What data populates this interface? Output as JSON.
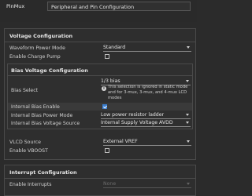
{
  "header": {
    "tag": "PinMux",
    "field_value": "Peripheral and Pin Configuration"
  },
  "voltage": {
    "title": "Voltage Configuration",
    "waveform_label": "Waveform Power Mode",
    "waveform_value": "Standard",
    "charge_pump_label": "Enable Charge Pump"
  },
  "bias": {
    "title": "Bias Voltage Configuration",
    "select_label": "Bias Select",
    "select_value": "1/3 bias",
    "info_text": "This selection is ignored in static mode and for 3-mux, 3-mux, and 4-mux LCD modes",
    "internal_enable_label": "Internal Bias Enable",
    "internal_power_label": "Internal Bias Power Mode",
    "internal_power_value": "Low power resistor ladder",
    "internal_source_label": "Internal Bias Voltage Source",
    "internal_source_value": "Internal Supply Voltage AVDD"
  },
  "vlcd": {
    "source_label": "VLCD Source",
    "source_value": "External VREF",
    "vboost_label": "Enable VBOOST"
  },
  "interrupt": {
    "title": "Interrupt Configuration",
    "enable_label": "Enable Interrupts",
    "enable_value": "None"
  },
  "colors": {
    "accent": "#3b7fd1",
    "background": "#2b2b2b"
  },
  "state": {
    "charge_pump_checked": false,
    "internal_bias_checked": true,
    "vboost_checked": false
  }
}
